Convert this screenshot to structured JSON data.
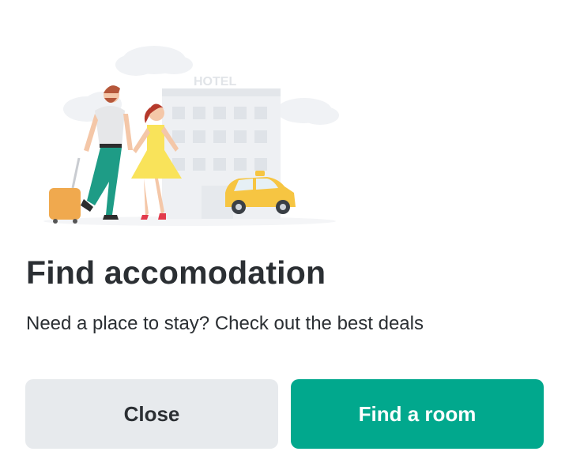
{
  "illustration": {
    "hotel_sign": "HOTEL",
    "icon": "travel-couple-hotel-illustration"
  },
  "dialog": {
    "title": "Find accomodation",
    "subtitle": "Need a place to stay? Check out the best deals"
  },
  "actions": {
    "close_label": "Close",
    "primary_label": "Find a room"
  },
  "colors": {
    "primary": "#01a88d",
    "secondary_bg": "#e7eaed",
    "text": "#2b2f33",
    "taxi": "#f6c542",
    "dress": "#f9e35a",
    "pants": "#1e9c86"
  }
}
